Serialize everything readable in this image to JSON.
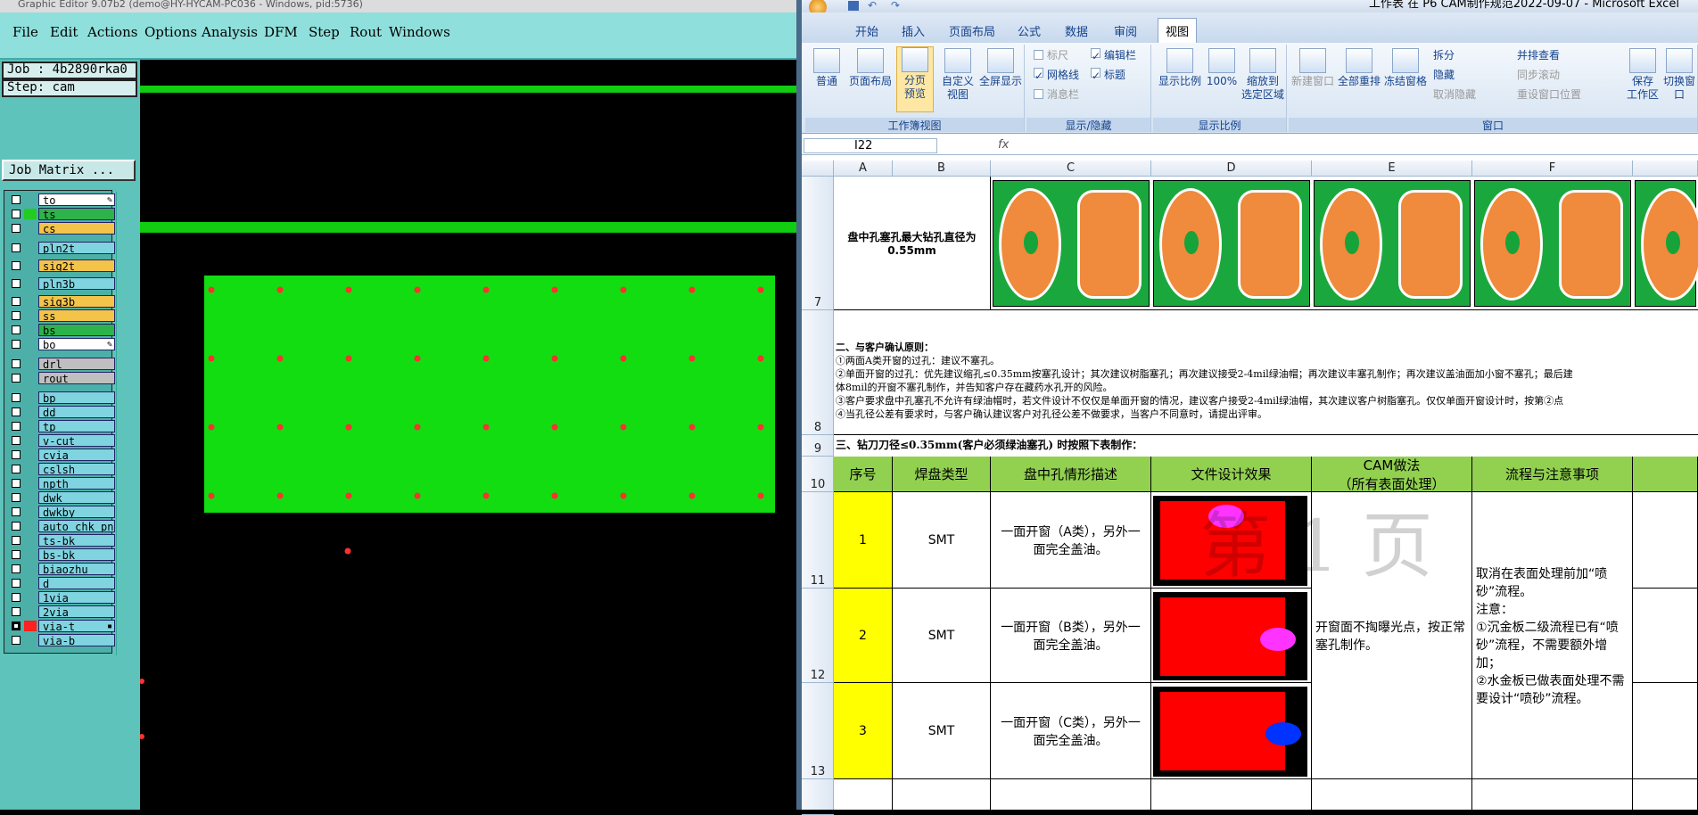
{
  "left_window": {
    "title": "Graphic Editor 9.07b2 (demo@HY-HYCAM-PC036 - Windows, pid:5736)",
    "menu": [
      "File",
      "Edit",
      "Actions",
      "Options",
      "Analysis",
      "DFM",
      "Step",
      "Rout",
      "Windows"
    ],
    "job_label": "Job : 4b2890rka0",
    "step_label": "Step: cam",
    "job_matrix_button": "Job Matrix ...",
    "layers": [
      {
        "name": "to",
        "color": "#ffffff",
        "swatch": "",
        "mark": "✎"
      },
      {
        "name": "ts",
        "color": "#2db34a",
        "swatch": "#22cc22",
        "mark": ""
      },
      {
        "name": "cs",
        "color": "#f4c44a",
        "swatch": "",
        "mark": ""
      },
      {
        "name": "pln2t",
        "color": "#7fd4e0",
        "swatch": "",
        "mark": ""
      },
      {
        "name": "sig2t",
        "color": "#f4c44a",
        "swatch": "",
        "mark": ""
      },
      {
        "name": "pln3b",
        "color": "#7fd4e0",
        "swatch": "",
        "mark": ""
      },
      {
        "name": "sig3b",
        "color": "#f4c44a",
        "swatch": "",
        "mark": ""
      },
      {
        "name": "ss",
        "color": "#f4c44a",
        "swatch": "",
        "mark": ""
      },
      {
        "name": "bs",
        "color": "#2db34a",
        "swatch": "",
        "mark": ""
      },
      {
        "name": "bo",
        "color": "#ffffff",
        "swatch": "",
        "mark": "✎"
      },
      {
        "name": "drl",
        "color": "#bfbfbf",
        "swatch": "",
        "mark": ""
      },
      {
        "name": "rout",
        "color": "#bfbfbf",
        "swatch": "",
        "mark": ""
      },
      {
        "name": "bp",
        "color": "#7fd4e0",
        "swatch": "",
        "mark": ""
      },
      {
        "name": "dd",
        "color": "#7fd4e0",
        "swatch": "",
        "mark": ""
      },
      {
        "name": "tp",
        "color": "#7fd4e0",
        "swatch": "",
        "mark": ""
      },
      {
        "name": "v-cut",
        "color": "#7fd4e0",
        "swatch": "",
        "mark": ""
      },
      {
        "name": "cvia",
        "color": "#7fd4e0",
        "swatch": "",
        "mark": ""
      },
      {
        "name": "cslsh",
        "color": "#7fd4e0",
        "swatch": "",
        "mark": ""
      },
      {
        "name": "npth",
        "color": "#7fd4e0",
        "swatch": "",
        "mark": ""
      },
      {
        "name": "dwk",
        "color": "#7fd4e0",
        "swatch": "",
        "mark": ""
      },
      {
        "name": "dwkby",
        "color": "#7fd4e0",
        "swatch": "",
        "mark": ""
      },
      {
        "name": "auto_chk_pnl",
        "color": "#7fd4e0",
        "swatch": "",
        "mark": ""
      },
      {
        "name": "ts-bk",
        "color": "#7fd4e0",
        "swatch": "",
        "mark": ""
      },
      {
        "name": "bs-bk",
        "color": "#7fd4e0",
        "swatch": "",
        "mark": ""
      },
      {
        "name": "biaozhu",
        "color": "#7fd4e0",
        "swatch": "",
        "mark": ""
      },
      {
        "name": "d",
        "color": "#7fd4e0",
        "swatch": "",
        "mark": ""
      },
      {
        "name": "1via",
        "color": "#7fd4e0",
        "swatch": "",
        "mark": ""
      },
      {
        "name": "2via",
        "color": "#7fd4e0",
        "swatch": "",
        "mark": ""
      },
      {
        "name": "via-t",
        "color": "#7fd4e0",
        "swatch": "#ff2020",
        "mark": "▪"
      },
      {
        "name": "via-b",
        "color": "#7fd4e0",
        "swatch": "",
        "mark": ""
      }
    ],
    "colors": {
      "board": "#11dd11",
      "via": "#ff3030",
      "strip": "#11cc11"
    }
  },
  "excel": {
    "title": "工作表 在 P6 CAM制作规范2022-09-07 - Microsoft Excel",
    "tabs": [
      "开始",
      "插入",
      "页面布局",
      "公式",
      "数据",
      "审阅",
      "视图"
    ],
    "active_tab": "视图",
    "ribbon": {
      "workbook_views": {
        "label": "工作簿视图",
        "buttons": [
          "普通",
          "页面布局",
          "分页\n预览",
          "自定义\n视图",
          "全屏显示"
        ]
      },
      "show_hide": {
        "label": "显示/隐藏",
        "items": [
          "标尺",
          "编辑栏",
          "网格线",
          "标题",
          "消息栏"
        ]
      },
      "zoom": {
        "label": "显示比例",
        "buttons": [
          "显示比例",
          "100%",
          "缩放到\n选定区域"
        ]
      },
      "window": {
        "label": "窗口",
        "buttons": [
          "新建窗口",
          "全部重排",
          "冻结窗格",
          "保存\n工作区",
          "切换窗口"
        ],
        "small": [
          "拆分",
          "隐藏",
          "取消隐藏",
          "并排查看",
          "同步滚动",
          "重设窗口位置"
        ]
      }
    },
    "name_box": "I22",
    "fx": "fx",
    "columns": [
      "A",
      "B",
      "C",
      "D",
      "E",
      "F"
    ],
    "rows": [
      "7",
      "8",
      "9",
      "10",
      "11",
      "12",
      "13"
    ],
    "row7_text": "盘中孔塞孔最大钻孔直径为0.55mm",
    "section2_lines": [
      "二、与客户确认原则：",
      "①两面A类开窗的过孔：建议不塞孔。",
      "②单面开窗的过孔：优先建议缩孔≤0.35mm按塞孔设计；其次建议树脂塞孔；再次建议接受2-4mil绿油帽；再次建议丰塞孔制作；再次建议盖油面加小窗不塞孔；最后建",
      "体8mil的开窗不塞孔制作，并告知客户存在藏药水孔开的风险。",
      "③客户要求盘中孔塞孔不允许有绿油帽时，若文件设计不仅仅是单面开窗的情况，建议客户接受2-4mil绿油帽，其次建议客户树脂塞孔。仅仅单面开窗设计时，按第②点",
      "④当孔径公差有要求时，与客户确认建议客户对孔径公差不做要求，当客户不同意时，请提出评审。"
    ],
    "section3_title": "三、钻刀刀径≤0.35mm(客户必须绿油塞孔) 时按照下表制作：",
    "table_headers": [
      "序号",
      "焊盘类型",
      "盘中孔情形描述",
      "文件设计效果",
      "CAM做法\n（所有表面处理）",
      "流程与注意事项"
    ],
    "table_rows": [
      {
        "seq": "1",
        "pad": "SMT",
        "desc": "一面开窗（A类），另外一面完全盖油。"
      },
      {
        "seq": "2",
        "pad": "SMT",
        "desc": "一面开窗（B类），另外一面完全盖油。"
      },
      {
        "seq": "3",
        "pad": "SMT",
        "desc": "一面开窗（C类），另外一面完全盖油。"
      }
    ],
    "cam_method": "开窗面不掏曝光点，按正常塞孔制作。",
    "flow_notes": "取消在表面处理前加“喷砂”流程。\n注意：\n①沉金板二级流程已有“喷砂”流程，不需要额外增加；\n②水金板已做表面处理不需要设计“喷砂”流程。",
    "watermark": "第 1 页"
  }
}
